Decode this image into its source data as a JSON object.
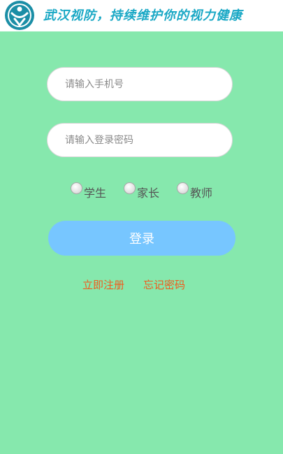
{
  "header": {
    "logo_icon": "wuhan-vision-logo-icon",
    "slogan": "武汉视防，持续维护你的视力健康",
    "slogan_color": "#1aa8c5"
  },
  "form": {
    "phone_placeholder": "请输入手机号",
    "phone_value": "",
    "password_placeholder": "请输入登录密码",
    "password_value": ""
  },
  "roles": {
    "student": "学生",
    "parent": "家长",
    "teacher": "教师",
    "selected": ""
  },
  "login_button": "登录",
  "links": {
    "register": "立即注册",
    "forgot": "忘记密码"
  },
  "colors": {
    "background": "#86e8ad",
    "button": "#77c6ff",
    "link": "#f15a1c"
  }
}
